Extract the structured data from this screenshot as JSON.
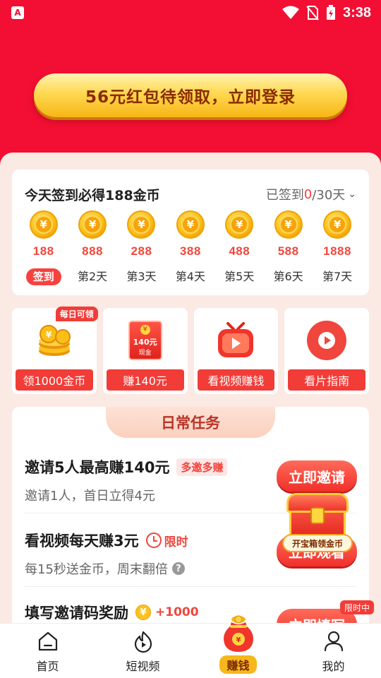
{
  "status_bar": {
    "time": "3:38",
    "notification_icon": "app-a-icon",
    "icons": [
      "wifi-icon",
      "no-sim-icon",
      "battery-charging-icon"
    ]
  },
  "colors": {
    "brand_red": "#f20f33",
    "accent_gold": "#f7b71c",
    "button_red": "#f23c38",
    "page_bg": "#fbe9e4"
  },
  "login_banner": {
    "label": "56元红包待领取，立即登录"
  },
  "checkin": {
    "title": "今天签到必得188金币",
    "status_prefix": "已签到",
    "status_count": "0",
    "status_suffix": "/30天",
    "days": [
      {
        "amount": "188",
        "label": "签到"
      },
      {
        "amount": "888",
        "label": "第2天"
      },
      {
        "amount": "288",
        "label": "第3天"
      },
      {
        "amount": "388",
        "label": "第4天"
      },
      {
        "amount": "488",
        "label": "第5天"
      },
      {
        "amount": "588",
        "label": "第6天"
      },
      {
        "amount": "1888",
        "label": "第7天"
      }
    ]
  },
  "shortcuts": [
    {
      "label": "领1000金币",
      "badge": "每日可领",
      "icon": "coin-stack-icon"
    },
    {
      "label": "赚140元",
      "icon": "red-packet-icon",
      "icon_text": "140元",
      "icon_subtext": "现金"
    },
    {
      "label": "看视频赚钱",
      "icon": "tv-play-icon"
    },
    {
      "label": "看片指南",
      "icon": "play-circle-icon"
    }
  ],
  "tasks": {
    "header": "日常任务",
    "items": [
      {
        "title": "邀请5人最高赚140元",
        "tag": "多邀多赚",
        "desc": "邀请1人，首日立得4元",
        "button": "立即邀请"
      },
      {
        "title": "看视频每天赚3元",
        "tag": "限时",
        "desc": "每15秒送金币，周末翻倍",
        "button": "立即观看"
      },
      {
        "title": "填写邀请码奖励",
        "reward": "+1000",
        "button": "立即填写",
        "badge": "限时中"
      }
    ],
    "treasure_label": "开宝箱领金币"
  },
  "bottom_nav": [
    {
      "label": "首页",
      "icon": "home-icon"
    },
    {
      "label": "短视频",
      "icon": "flame-icon"
    },
    {
      "label": "赚钱",
      "icon": "money-bag-icon"
    },
    {
      "label": "我的",
      "icon": "user-icon"
    }
  ]
}
